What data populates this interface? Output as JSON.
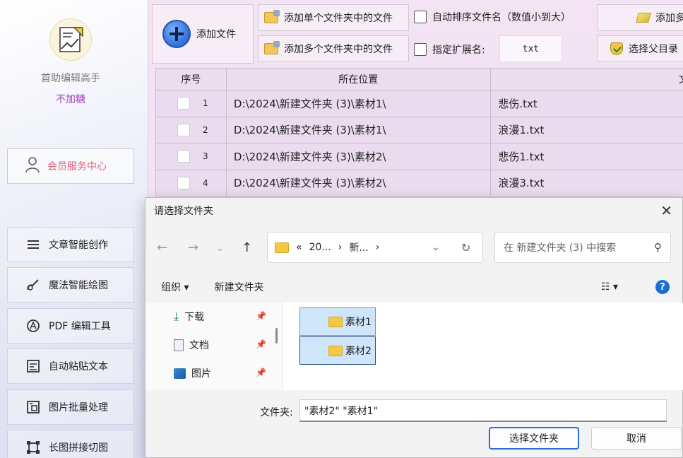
{
  "sidebar": {
    "app_name": "首助编辑高手",
    "app_sub": "不加糖",
    "member_label": "会员服务中心",
    "items": [
      {
        "label": "文章智能创作",
        "icon": "list-icon"
      },
      {
        "label": "魔法智能绘图",
        "icon": "magic-brush-icon"
      },
      {
        "label": "PDF 编辑工具",
        "icon": "pdf-icon"
      },
      {
        "label": "自动粘贴文本",
        "icon": "paste-icon"
      },
      {
        "label": "图片批量处理",
        "icon": "image-icon"
      },
      {
        "label": "长图拼接切图",
        "icon": "crop-icon"
      }
    ]
  },
  "toolbar": {
    "add_file": "添加文件",
    "add_single_folder": "添加单个文件夹中的文件",
    "add_multi_folder": "添加多个文件夹中的文件",
    "auto_sort": "自动排序文件名（数值小到大）",
    "specify_ext": "指定扩展名:",
    "ext_value": "txt",
    "add_right": "添加多",
    "select_parent": "选择父目录"
  },
  "table": {
    "headers": [
      "序号",
      "所在位置",
      "文"
    ],
    "rows": [
      {
        "index": "1",
        "location": "D:\\2024\\新建文件夹 (3)\\素材1\\",
        "name": "悲伤.txt"
      },
      {
        "index": "2",
        "location": "D:\\2024\\新建文件夹 (3)\\素材1\\",
        "name": "浪漫1.txt"
      },
      {
        "index": "3",
        "location": "D:\\2024\\新建文件夹 (3)\\素材2\\",
        "name": "悲伤1.txt"
      },
      {
        "index": "4",
        "location": "D:\\2024\\新建文件夹 (3)\\素材2\\",
        "name": "浪漫3.txt"
      }
    ]
  },
  "dialog": {
    "title": "请选择文件夹",
    "address": [
      "«",
      "20...",
      "›",
      "新...",
      "›"
    ],
    "search_placeholder": "在 新建文件夹 (3) 中搜索",
    "organize": "组织 ▾",
    "new_folder": "新建文件夹",
    "nav_items": [
      {
        "label": "下载",
        "icon": "download-icon"
      },
      {
        "label": "文档",
        "icon": "document-icon"
      },
      {
        "label": "图片",
        "icon": "picture-icon"
      }
    ],
    "folders": [
      "素材1",
      "素材2"
    ],
    "folder_label": "文件夹:",
    "folder_value": "\"素材2\" \"素材1\"",
    "select_button": "选择文件夹",
    "cancel_button": "取消"
  }
}
